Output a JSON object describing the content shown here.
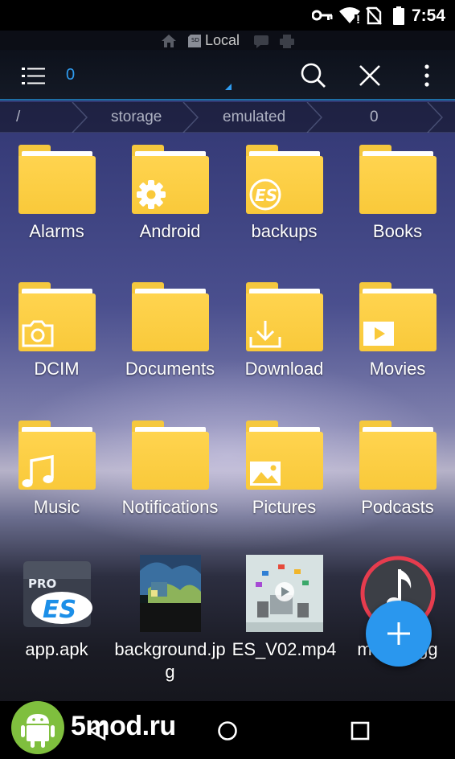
{
  "status_bar": {
    "time": "7:54"
  },
  "location": {
    "label": "Local"
  },
  "toolbar": {
    "tab_count": "0"
  },
  "breadcrumb": [
    "/",
    "storage",
    "emulated",
    "0"
  ],
  "items": [
    {
      "label": "Alarms",
      "icon": "folder-icon"
    },
    {
      "label": "Android",
      "icon": "folder-android-icon"
    },
    {
      "label": "backups",
      "icon": "folder-es-icon"
    },
    {
      "label": "Books",
      "icon": "folder-icon"
    },
    {
      "label": "DCIM",
      "icon": "folder-camera-icon"
    },
    {
      "label": "Documents",
      "icon": "folder-icon"
    },
    {
      "label": "Download",
      "icon": "folder-download-icon"
    },
    {
      "label": "Movies",
      "icon": "folder-play-icon"
    },
    {
      "label": "Music",
      "icon": "folder-music-icon"
    },
    {
      "label": "Notifications",
      "icon": "folder-icon"
    },
    {
      "label": "Pictures",
      "icon": "folder-image-icon"
    },
    {
      "label": "Podcasts",
      "icon": "folder-icon"
    },
    {
      "label": "app.apk",
      "icon": "es-pro-app-icon"
    },
    {
      "label": "background.jpg",
      "icon": "image-thumbnail"
    },
    {
      "label": "ES_V02.mp4",
      "icon": "video-thumbnail"
    },
    {
      "label": "music.ogg",
      "icon": "audio-file-icon"
    }
  ],
  "watermark": {
    "text": "5mod.ru"
  },
  "colors": {
    "accent": "#2f9cf0",
    "folder": "#f9c93a",
    "fab": "#2a97ee"
  }
}
